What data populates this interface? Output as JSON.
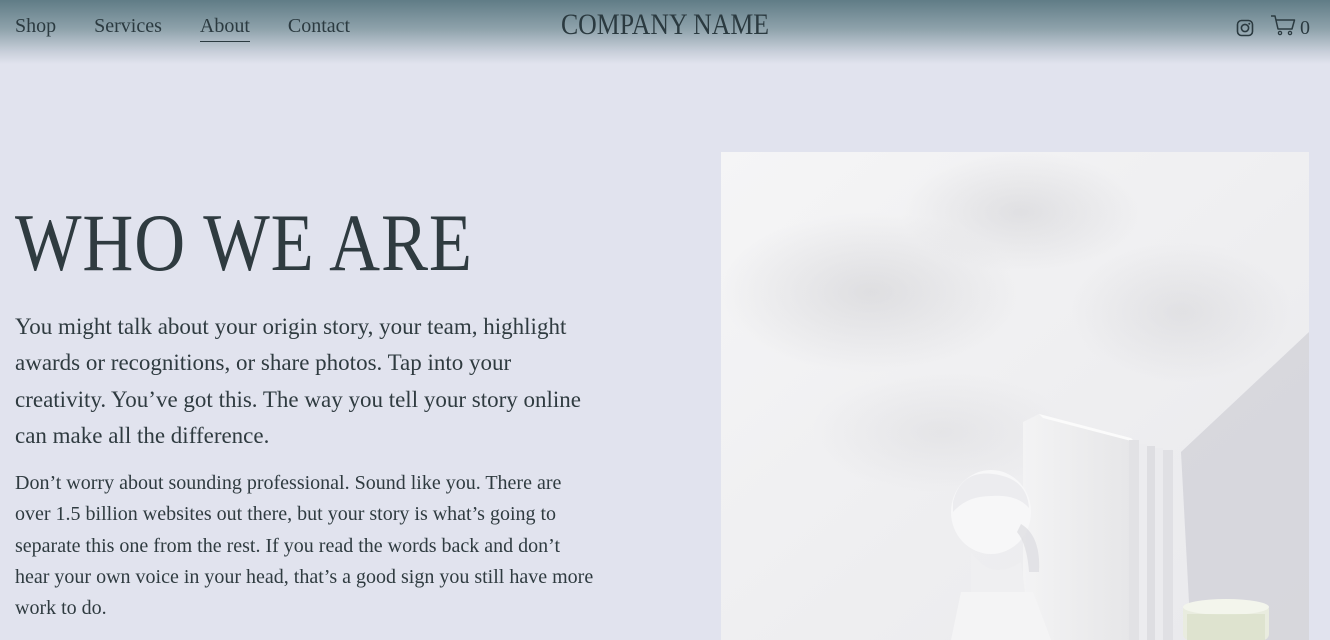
{
  "header": {
    "nav": [
      {
        "label": "Shop"
      },
      {
        "label": "Services"
      },
      {
        "label": "About"
      },
      {
        "label": "Contact"
      }
    ],
    "active_nav": "About",
    "brand": "COMPANY NAME",
    "social_icon": "instagram-icon",
    "cart_icon": "cart-icon",
    "cart_count": "0"
  },
  "main": {
    "title": "WHO WE ARE",
    "lead": "You might talk about your origin story, your team, highlight awards or recognitions, or share photos. Tap into your creativity. You’ve got this. The way you tell your story online can make all the difference.",
    "body": "Don’t worry about sounding professional. Sound like you. There are over 1.5 billion websites out there, but your story is what’s going to separate this one from the rest. If you read the words back and don’t hear your own voice in your head, that’s a good sign you still have more work to do."
  },
  "colors": {
    "background": "#e1e3ee",
    "header_top": "#607c86",
    "text": "#2f3b40"
  }
}
